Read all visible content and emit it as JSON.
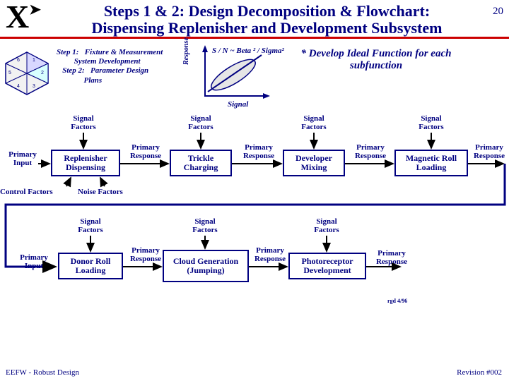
{
  "page_number": "20",
  "title_line1": "Steps 1 & 2: Design Decomposition & Flowchart:",
  "title_line2": "Dispensing Replenisher and Development Subsystem",
  "logo_text": "X",
  "steps": {
    "s1a": "Step 1:",
    "s1b": "Fixture & Measurement",
    "s1c": "System Development",
    "s2a": "Step 2:",
    "s2b": "Parameter Design",
    "s2c": "Plans"
  },
  "chart": {
    "formula": "S / N ~ Beta ² / Sigma²",
    "ylab": "Response",
    "xlab": "Signal"
  },
  "ideal_func": "* Develop Ideal Function for each subfunction",
  "labels": {
    "signal_factors": "Signal Factors",
    "primary_input": "Primary Input",
    "primary_response": "Primary Response",
    "control_factors": "Control Factors",
    "noise_factors": "Noise Factors"
  },
  "boxes": {
    "b1": "Replenisher Dispensing",
    "b2": "Trickle Charging",
    "b3": "Developer Mixing",
    "b4": "Magnetic Roll Loading",
    "b5": "Donor Roll Loading",
    "b6": "Cloud Generation (Jumping)",
    "b7": "Photoreceptor Development"
  },
  "small_code": "rgd 4/96",
  "footer_left": "EEFW - Robust Design",
  "footer_right": "Revision #002"
}
